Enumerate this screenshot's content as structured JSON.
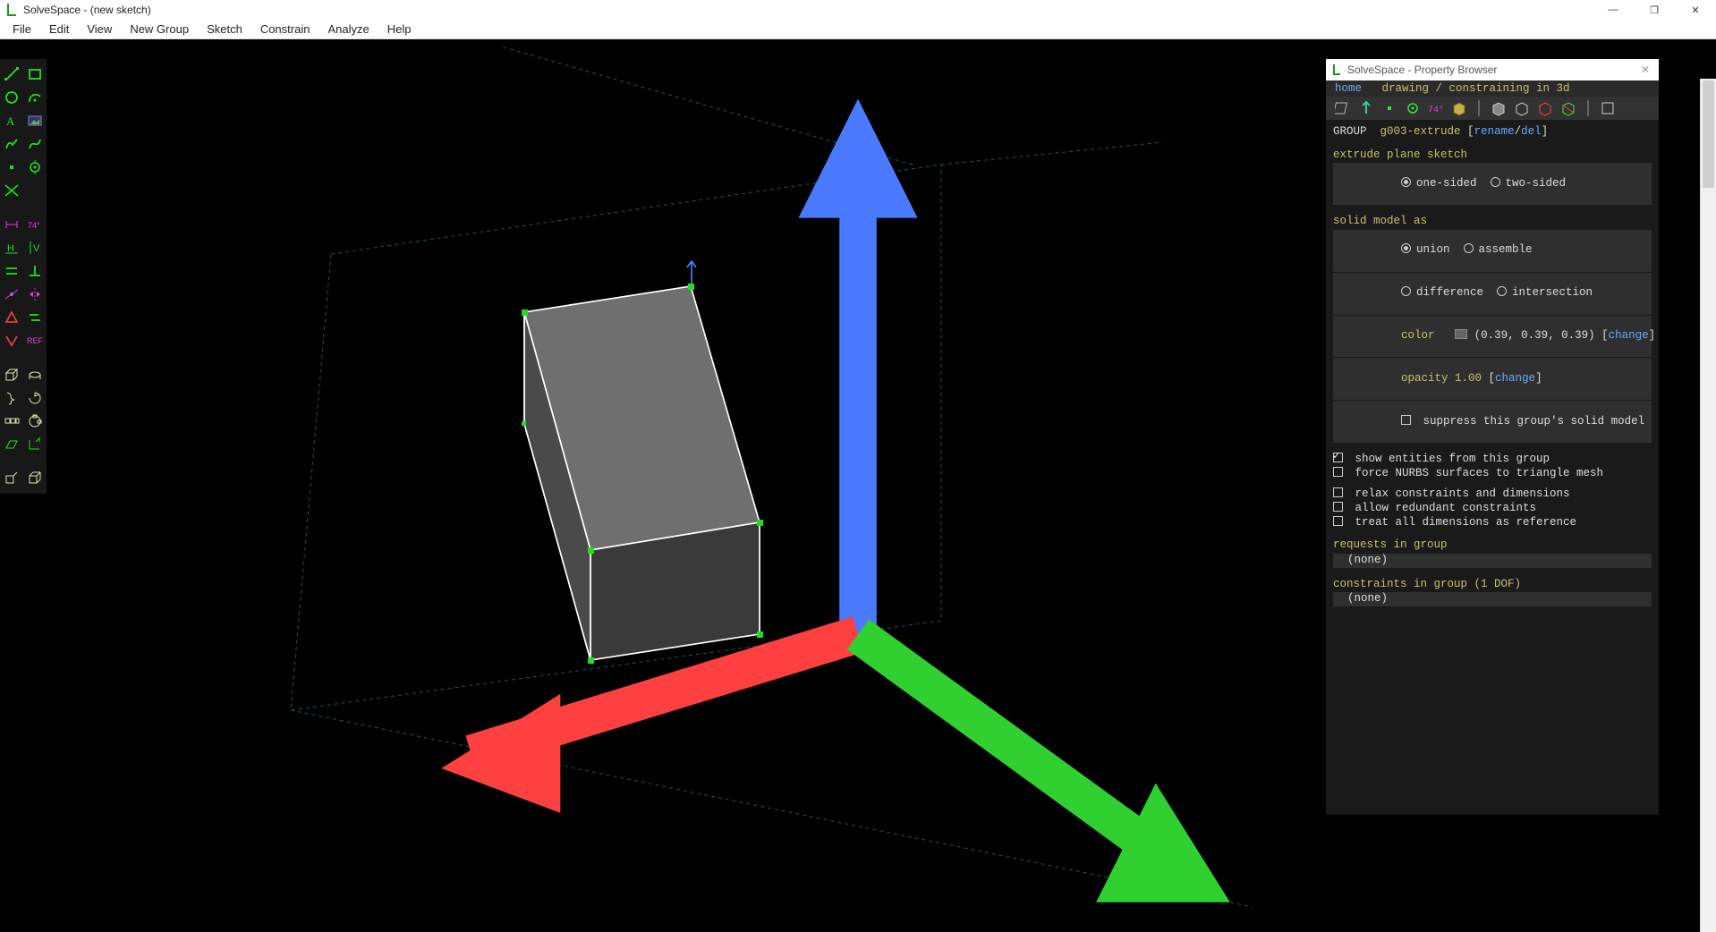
{
  "window": {
    "title": "SolveSpace - (new sketch)"
  },
  "menu": [
    "File",
    "Edit",
    "View",
    "New Group",
    "Sketch",
    "Constrain",
    "Analyze",
    "Help"
  ],
  "toolbar": {
    "groups": [
      {
        "items": [
          {
            "name": "line-tool"
          },
          {
            "name": "rectangle-tool"
          }
        ]
      },
      {
        "items": [
          {
            "name": "circle-tool"
          },
          {
            "name": "arc-tool"
          }
        ]
      },
      {
        "items": [
          {
            "name": "text-tool"
          },
          {
            "name": "image-tool"
          }
        ]
      },
      {
        "items": [
          {
            "name": "tangent-arc-tool"
          },
          {
            "name": "bezier-tool"
          }
        ]
      },
      {
        "items": [
          {
            "name": "point-tool"
          },
          {
            "name": "construction-tool"
          }
        ]
      },
      {
        "items": [
          {
            "name": "split-curve-tool"
          }
        ]
      }
    ],
    "groups2": [
      {
        "items": [
          {
            "name": "distance-constraint",
            "cls": "magenta"
          },
          {
            "name": "angle-constraint",
            "cls": "magenta"
          }
        ]
      },
      {
        "items": [
          {
            "name": "horizontal-constraint"
          },
          {
            "name": "vertical-constraint"
          }
        ]
      },
      {
        "items": [
          {
            "name": "parallel-constraint"
          },
          {
            "name": "perpendicular-constraint"
          }
        ]
      },
      {
        "items": [
          {
            "name": "point-on-constraint",
            "cls": "magenta"
          },
          {
            "name": "symmetric-constraint",
            "cls": "magenta"
          }
        ]
      },
      {
        "items": [
          {
            "name": "equal-constraint",
            "cls": "red"
          },
          {
            "name": "same-orientation-constraint"
          }
        ]
      },
      {
        "items": [
          {
            "name": "other-constraint",
            "cls": "red"
          },
          {
            "name": "reference-tool",
            "cls": "magenta",
            "text": "REF"
          }
        ]
      }
    ],
    "groups3": [
      {
        "items": [
          {
            "name": "extrude-tool",
            "cls": "cream"
          },
          {
            "name": "lathe-tool",
            "cls": "cream"
          }
        ]
      },
      {
        "items": [
          {
            "name": "helix-tool",
            "cls": "cream"
          },
          {
            "name": "revolve-tool",
            "cls": "cream"
          }
        ]
      },
      {
        "items": [
          {
            "name": "step-translate-tool",
            "cls": "cream"
          },
          {
            "name": "step-rotate-tool",
            "cls": "cream"
          }
        ]
      },
      {
        "items": [
          {
            "name": "sketch-in-3d-tool"
          },
          {
            "name": "sketch-flat-tool"
          }
        ]
      }
    ],
    "groups4": [
      {
        "items": [
          {
            "name": "nearest-ortho-tool",
            "cls": "cream"
          },
          {
            "name": "nearest-iso-tool",
            "cls": "cream"
          }
        ]
      }
    ]
  },
  "propertyBrowser": {
    "title": "SolveSpace - Property Browser",
    "crumbHome": "home",
    "crumbRest": "   drawing / constraining in 3d",
    "groupLabel": "GROUP",
    "groupName": "g003-extrude",
    "rename": "rename",
    "del": "del",
    "section1Title": "extrude plane sketch",
    "oneSided": "one-sided",
    "twoSided": "two-sided",
    "section2Title": "solid model as",
    "union": "union",
    "assemble": "assemble",
    "difference": "difference",
    "intersection": "intersection",
    "colorLabel": "color",
    "rgb": "(0.39, 0.39, 0.39)",
    "change": "change",
    "opacityLabel": "opacity 1.00",
    "suppress": "suppress this group's solid model",
    "showEntities": "show entities from this group",
    "forceNurbs": "force NURBS surfaces to triangle mesh",
    "relax": "relax constraints and dimensions",
    "redundant": "allow redundant constraints",
    "treatRef": "treat all dimensions as reference",
    "reqLabel": "requests in group",
    "none": "(none)",
    "consLabel": "constraints in group (1 DOF)"
  }
}
